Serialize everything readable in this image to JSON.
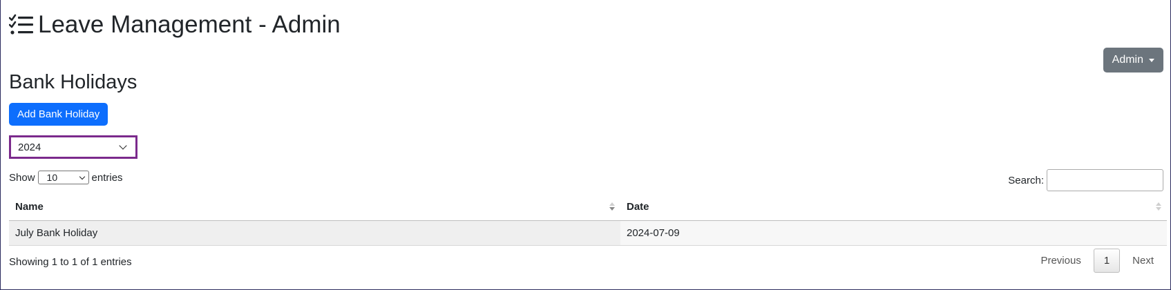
{
  "header": {
    "app_title": "Leave Management - Admin",
    "user_menu_label": "Admin"
  },
  "page": {
    "title": "Bank Holidays",
    "add_button_label": "Add Bank Holiday",
    "year_select_value": "2024"
  },
  "table_controls": {
    "show_label": "Show",
    "page_length_value": "10",
    "entries_label": "entries",
    "search_label": "Search:",
    "search_value": ""
  },
  "table": {
    "columns": [
      "Name",
      "Date"
    ],
    "rows": [
      [
        "July Bank Holiday",
        "2024-07-09"
      ]
    ]
  },
  "footer": {
    "info_text": "Showing 1 to 1 of 1 entries",
    "previous_label": "Previous",
    "current_page": "1",
    "next_label": "Next"
  },
  "colors": {
    "primary_button": "#0d6efd",
    "secondary_button": "#6c757d",
    "focus_outline": "#7b2a8c"
  }
}
